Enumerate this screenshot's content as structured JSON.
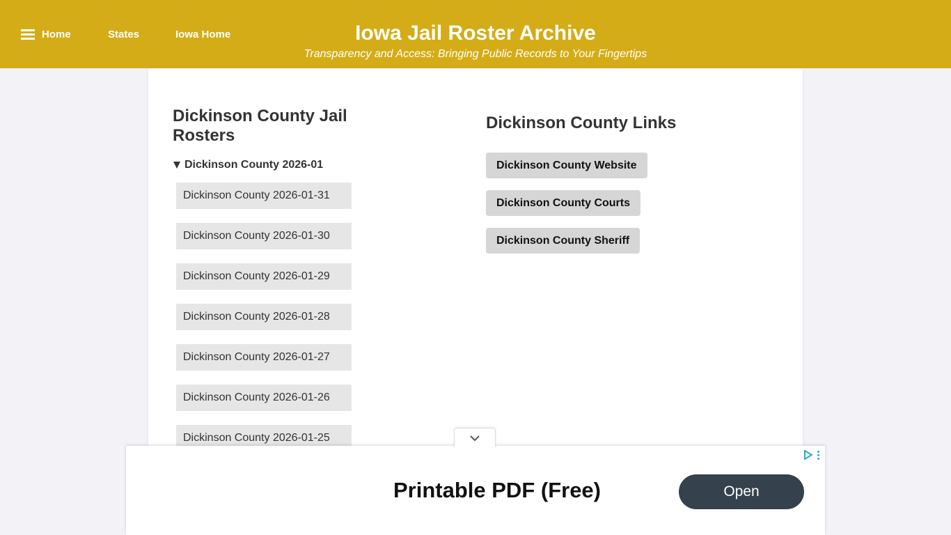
{
  "nav": {
    "home": "Home",
    "states": "States",
    "iowa_home": "Iowa Home"
  },
  "header": {
    "title": "Iowa Jail Roster Archive",
    "tagline": "Transparency and Access: Bringing Public Records to Your Fingertips"
  },
  "rosters": {
    "heading": "Dickinson County Jail Rosters",
    "group_label": "Dickinson County 2026-01",
    "items": [
      "Dickinson County 2026-01-31",
      "Dickinson County 2026-01-30",
      "Dickinson County 2026-01-29",
      "Dickinson County 2026-01-28",
      "Dickinson County 2026-01-27",
      "Dickinson County 2026-01-26",
      "Dickinson County 2026-01-25"
    ]
  },
  "links": {
    "heading": "Dickinson County Links",
    "items": [
      "Dickinson County Website",
      "Dickinson County Courts",
      "Dickinson County Sheriff"
    ]
  },
  "ad": {
    "headline": "Printable PDF (Free)",
    "button": "Open"
  },
  "colors": {
    "header_bg": "#d4ac17",
    "page_bg": "#f2f2f7",
    "roster_item_bg": "#e6e6e6",
    "link_button_bg": "#d6d6d6",
    "ad_button_bg": "#35414d",
    "ad_choices_accent": "#2aa8d8"
  },
  "icons": {
    "menu": "hamburger-menu-icon",
    "disclosure": "triangle-down-icon",
    "collapse": "chevron-down-icon",
    "ad_choices": "ad-choices-play-icon",
    "ad_more": "vertical-dots-icon"
  }
}
